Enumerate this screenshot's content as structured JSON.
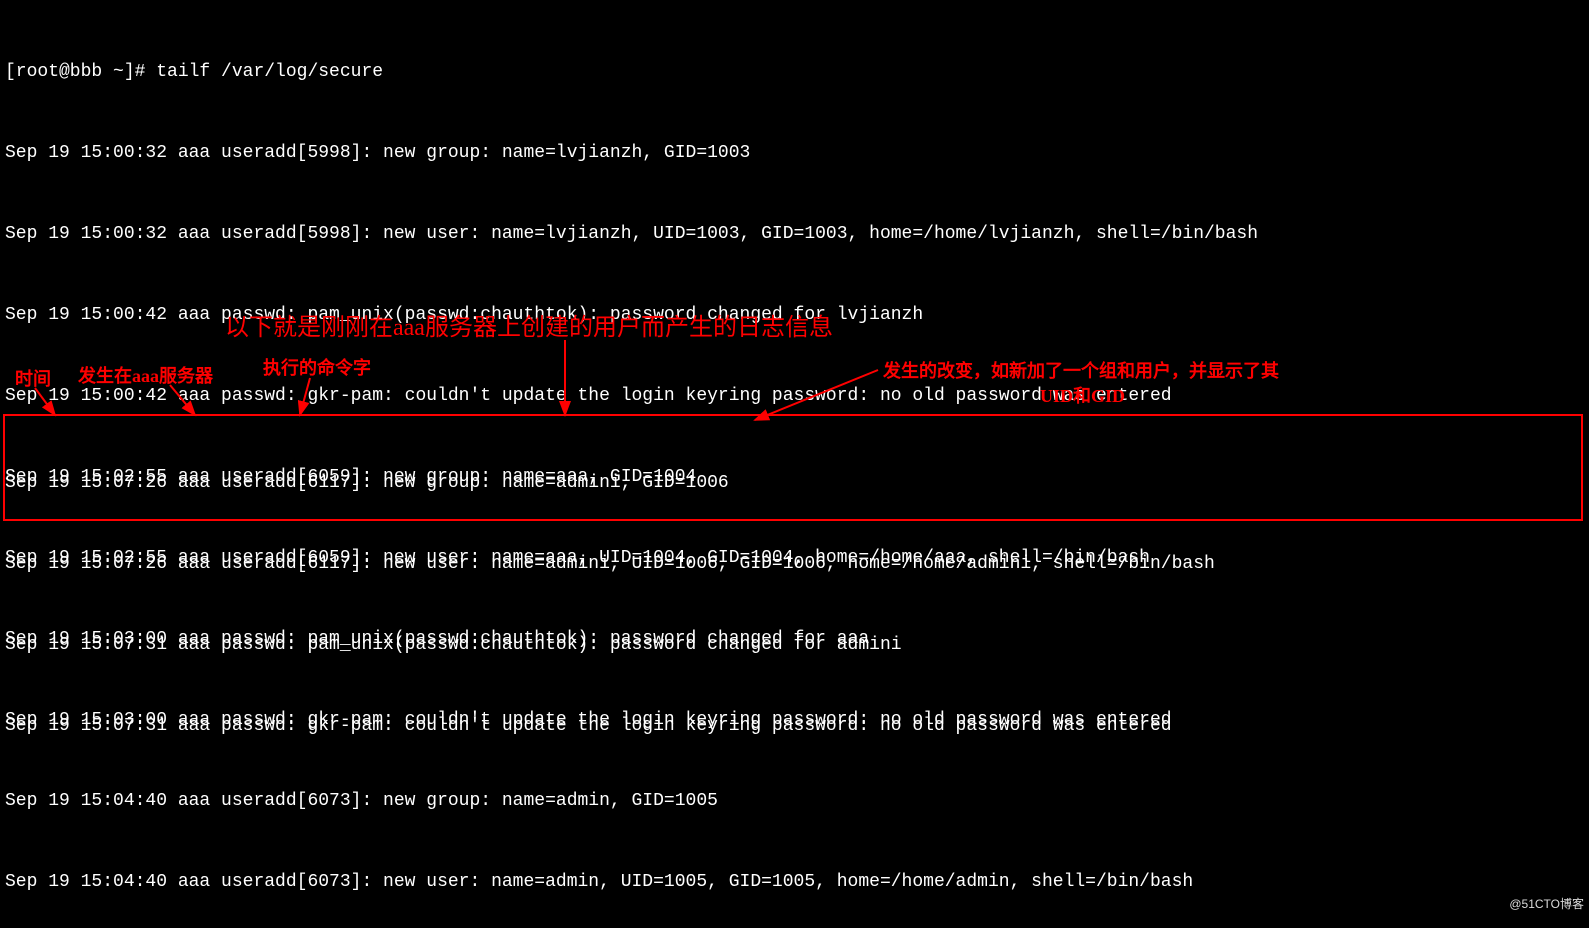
{
  "prompt": "[root@bbb ~]# tailf /var/log/secure",
  "log_lines": [
    "Sep 19 15:00:32 aaa useradd[5998]: new group: name=lvjianzh, GID=1003",
    "Sep 19 15:00:32 aaa useradd[5998]: new user: name=lvjianzh, UID=1003, GID=1003, home=/home/lvjianzh, shell=/bin/bash",
    "Sep 19 15:00:42 aaa passwd: pam_unix(passwd:chauthtok): password changed for lvjianzh",
    "Sep 19 15:00:42 aaa passwd: gkr-pam: couldn't update the login keyring password: no old password was entered",
    "Sep 19 15:02:55 aaa useradd[6059]: new group: name=aaa, GID=1004",
    "Sep 19 15:02:55 aaa useradd[6059]: new user: name=aaa, UID=1004, GID=1004, home=/home/aaa, shell=/bin/bash",
    "Sep 19 15:03:00 aaa passwd: pam_unix(passwd:chauthtok): password changed for aaa",
    "Sep 19 15:03:00 aaa passwd: gkr-pam: couldn't update the login keyring password: no old password was entered",
    "Sep 19 15:04:40 aaa useradd[6073]: new group: name=admin, GID=1005",
    "Sep 19 15:04:40 aaa useradd[6073]: new user: name=admin, UID=1005, GID=1005, home=/home/admin, shell=/bin/bash"
  ],
  "boxed_lines": [
    "Sep 19 15:07:26 aaa useradd[6117]: new group: name=admini, GID=1006",
    "Sep 19 15:07:26 aaa useradd[6117]: new user: name=admini, UID=1006, GID=1006, home=/home/admini, shell=/bin/bash",
    "Sep 19 15:07:31 aaa passwd: pam_unix(passwd:chauthtok): password changed for admini",
    "Sep 19 15:07:31 aaa passwd: gkr-pam: couldn't update the login keyring password: no old password was entered"
  ],
  "annotations": {
    "main": "以下就是刚刚在aaa服务器上创建的用户而产生的日志信息",
    "time": "时间",
    "server": "发生在aaa服务器",
    "command": "执行的命令字",
    "change_line1": "发生的改变，如新加了一个组和用户，并显示了其",
    "change_line2": "UID和GID"
  },
  "watermark": "@51CTO博客"
}
